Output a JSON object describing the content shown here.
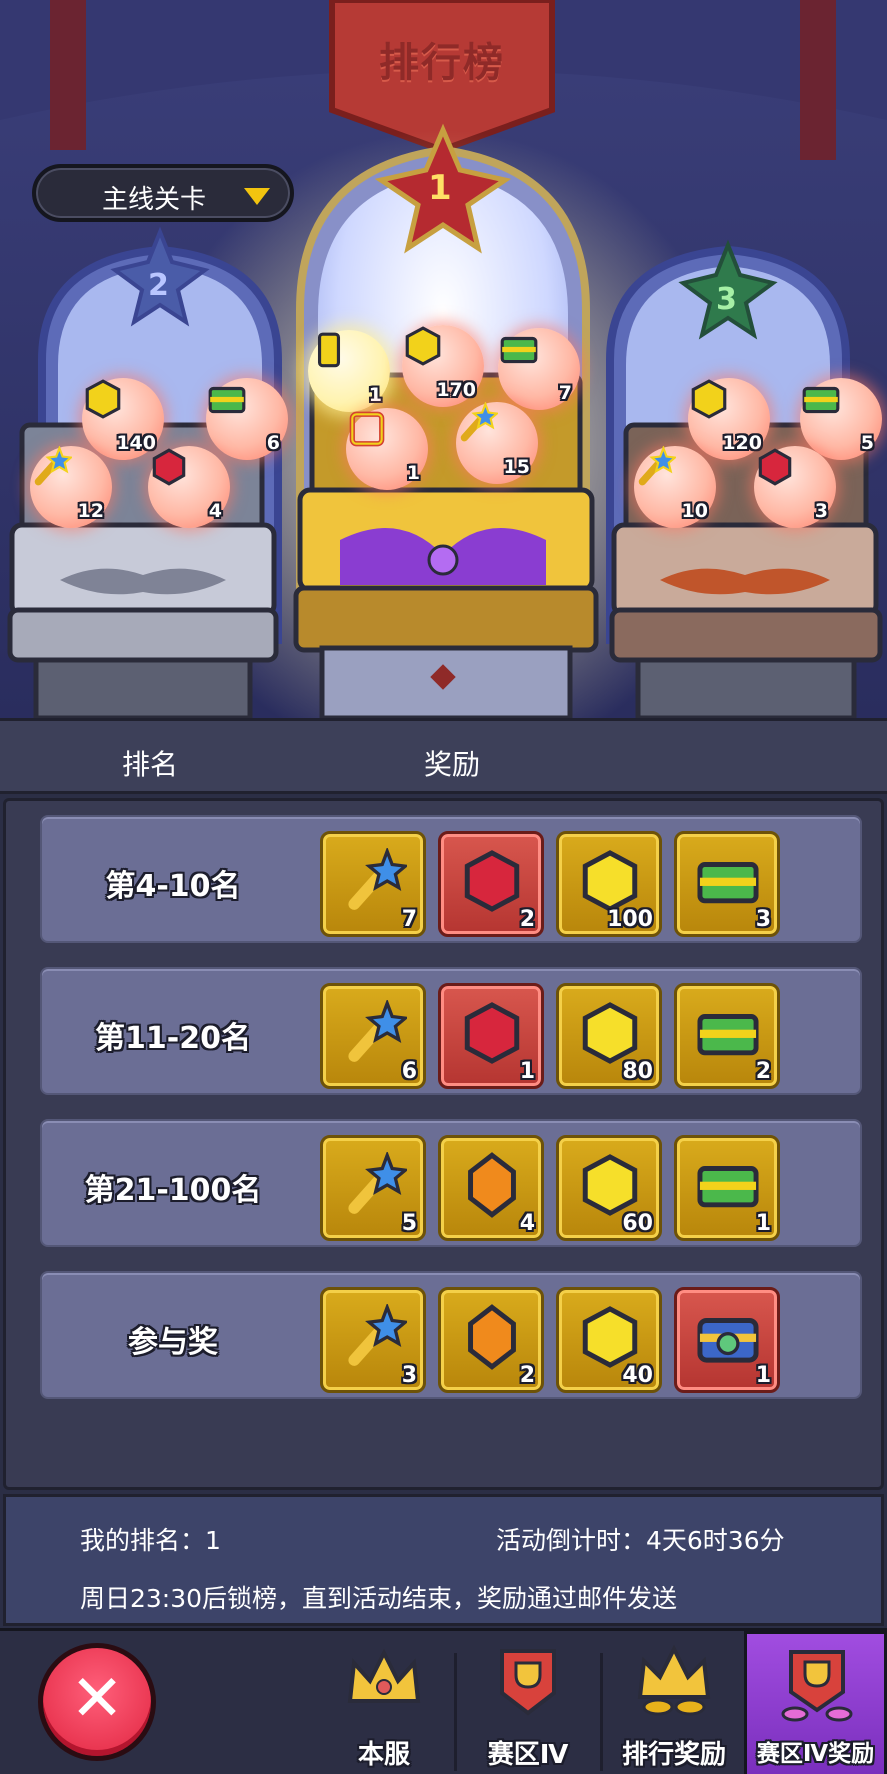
{
  "banner_title": "排行榜",
  "dropdown": {
    "label": "主线关卡"
  },
  "podium": [
    {
      "rank": "1",
      "rewards": [
        {
          "icon": "gold-bar-icon",
          "count": "1"
        },
        {
          "icon": "gold-coin-icon",
          "count": "170"
        },
        {
          "icon": "outfit-chest-icon",
          "count": "7"
        },
        {
          "icon": "avatar-frame-icon",
          "count": "1"
        },
        {
          "icon": "star-key-icon",
          "count": "15"
        }
      ]
    },
    {
      "rank": "2",
      "rewards": [
        {
          "icon": "gold-coin-icon",
          "count": "140"
        },
        {
          "icon": "outfit-chest-icon",
          "count": "6"
        },
        {
          "icon": "star-key-icon",
          "count": "12"
        },
        {
          "icon": "ruby-icon",
          "count": "4"
        }
      ]
    },
    {
      "rank": "3",
      "rewards": [
        {
          "icon": "gold-coin-icon",
          "count": "120"
        },
        {
          "icon": "outfit-chest-icon",
          "count": "5"
        },
        {
          "icon": "star-key-icon",
          "count": "10"
        },
        {
          "icon": "ruby-icon",
          "count": "3"
        }
      ]
    }
  ],
  "table": {
    "col_rank": "排名",
    "col_reward": "奖励",
    "rows": [
      {
        "rank": "第4-10名",
        "rewards": [
          {
            "icon": "star-key-icon",
            "count": "7",
            "frame": "gold"
          },
          {
            "icon": "ruby-icon",
            "count": "2",
            "frame": "red"
          },
          {
            "icon": "gold-coin-icon",
            "count": "100",
            "frame": "gold"
          },
          {
            "icon": "outfit-chest-icon",
            "count": "3",
            "frame": "gold"
          }
        ]
      },
      {
        "rank": "第11-20名",
        "rewards": [
          {
            "icon": "star-key-icon",
            "count": "6",
            "frame": "gold"
          },
          {
            "icon": "ruby-icon",
            "count": "1",
            "frame": "red"
          },
          {
            "icon": "gold-coin-icon",
            "count": "80",
            "frame": "gold"
          },
          {
            "icon": "outfit-chest-icon",
            "count": "2",
            "frame": "gold"
          }
        ]
      },
      {
        "rank": "第21-100名",
        "rewards": [
          {
            "icon": "star-key-icon",
            "count": "5",
            "frame": "gold"
          },
          {
            "icon": "amber-gem-icon",
            "count": "4",
            "frame": "gold"
          },
          {
            "icon": "gold-coin-icon",
            "count": "60",
            "frame": "gold"
          },
          {
            "icon": "outfit-chest-icon",
            "count": "1",
            "frame": "gold"
          }
        ]
      },
      {
        "rank": "参与奖",
        "rewards": [
          {
            "icon": "star-key-icon",
            "count": "3",
            "frame": "gold"
          },
          {
            "icon": "amber-gem-icon",
            "count": "2",
            "frame": "gold"
          },
          {
            "icon": "gold-coin-icon",
            "count": "40",
            "frame": "gold"
          },
          {
            "icon": "mystery-chest-icon",
            "count": "1",
            "frame": "red"
          }
        ]
      }
    ]
  },
  "info": {
    "my_rank": "我的排名：1",
    "countdown": "活动倒计时：4天6时36分",
    "notice": "周日23:30后锁榜，直到活动结束，奖励通过邮件发送"
  },
  "nav": {
    "tabs": [
      {
        "label": "本服",
        "icon": "crown-icon"
      },
      {
        "label": "赛区Ⅳ",
        "icon": "trophy-banner-icon"
      },
      {
        "label": "排行奖励",
        "icon": "crown-coins-icon"
      },
      {
        "label": "赛区Ⅳ奖励",
        "icon": "trophy-banner-gems-icon"
      }
    ],
    "active_index": 3
  },
  "colors": {
    "gold": "#f2c40f",
    "accent_purple": "#8a3dd1",
    "close_red": "#e0243f"
  }
}
